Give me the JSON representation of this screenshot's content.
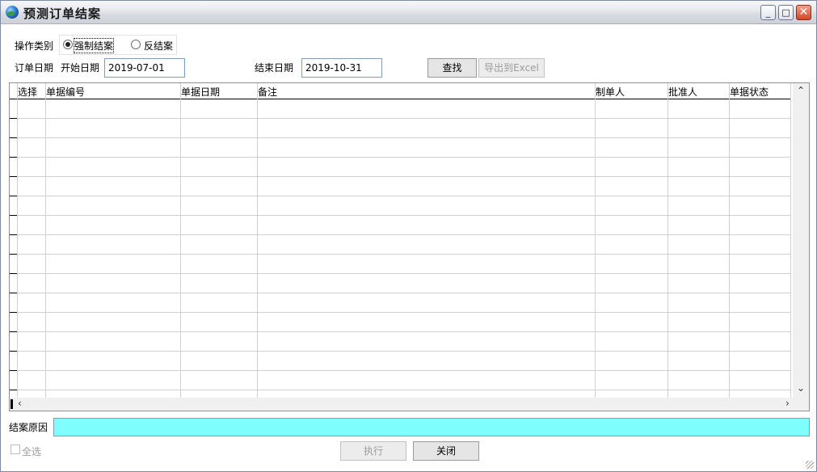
{
  "window": {
    "title": "预测订单结案",
    "controls": {
      "minimize": "_",
      "maximize": "□",
      "close": "✕"
    }
  },
  "operation": {
    "label": "操作类别",
    "options": [
      {
        "label": "强制结案",
        "selected": true
      },
      {
        "label": "反结案",
        "selected": false
      }
    ]
  },
  "order_date": {
    "label": "订单日期",
    "start_label": "开始日期",
    "start_value": "2019-07-01",
    "end_label": "结束日期",
    "end_value": "2019-10-31"
  },
  "toolbar": {
    "search_label": "查找",
    "export_label": "导出到Excel"
  },
  "grid": {
    "columns": [
      "选择",
      "单据编号",
      "单据日期",
      "备注",
      "制单人",
      "批准人",
      "单据状态"
    ],
    "rows": []
  },
  "reason": {
    "label": "结案原因",
    "value": "",
    "bg_color": "#80ffff"
  },
  "footer": {
    "select_all_label": "全选",
    "execute_label": "执行",
    "close_label": "关闭"
  }
}
